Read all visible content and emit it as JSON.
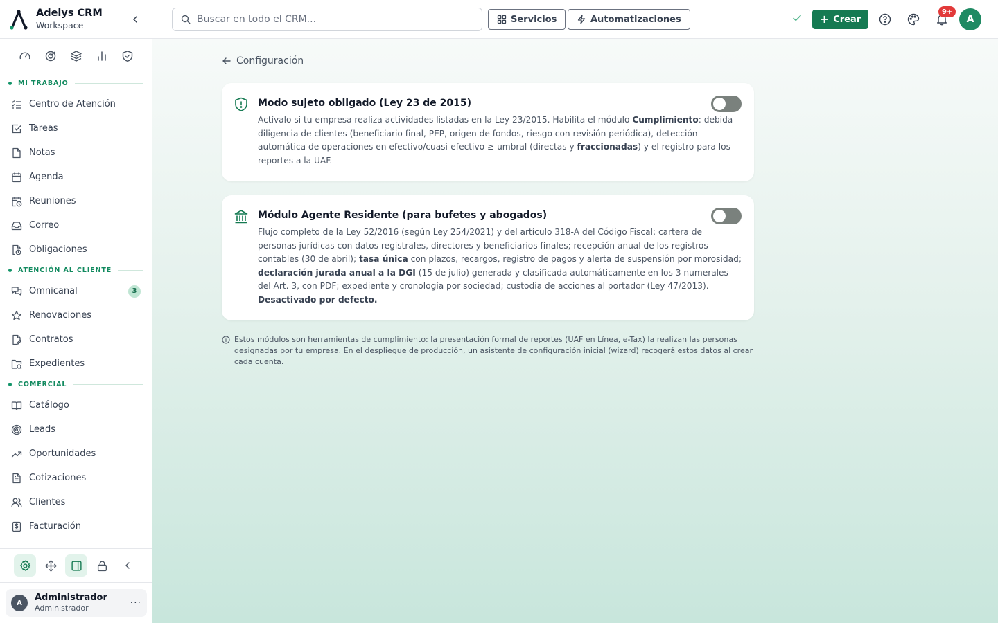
{
  "brand": {
    "name": "Adelys CRM",
    "subtitle": "Workspace"
  },
  "colors": {
    "accent": "#157a52",
    "badge": "#e23a3a",
    "toggle_off": "#7a817d"
  },
  "quick_icons": [
    "gauge-icon",
    "target-icon",
    "layers-icon",
    "bar-chart-icon",
    "shield-check-icon"
  ],
  "sections": {
    "mi_trabajo": "MI TRABAJO",
    "atencion": "ATENCIÓN AL CLIENTE",
    "comercial": "COMERCIAL"
  },
  "nav": {
    "centro": "Centro de Atención",
    "tareas": "Tareas",
    "notas": "Notas",
    "agenda": "Agenda",
    "reuniones": "Reuniones",
    "correo": "Correo",
    "obligaciones": "Obligaciones",
    "omnicanal": "Omnicanal",
    "omnicanal_count": "3",
    "renovaciones": "Renovaciones",
    "contratos": "Contratos",
    "expedientes": "Expedientes",
    "catalogo": "Catálogo",
    "leads": "Leads",
    "oportunidades": "Oportunidades",
    "cotizaciones": "Cotizaciones",
    "clientes": "Clientes",
    "facturacion": "Facturación"
  },
  "user": {
    "initial": "A",
    "name": "Administrador",
    "role": "Administrador",
    "menu": "···"
  },
  "topbar": {
    "search_placeholder": "Buscar en todo el CRM...",
    "servicios": "Servicios",
    "automatizaciones": "Automatizaciones",
    "crear": "Crear",
    "notifications_badge": "9+",
    "avatar_initial": "A"
  },
  "page": {
    "back_label": "Configuración",
    "card1": {
      "title": "Modo sujeto obligado (Ley 23 de 2015)",
      "enabled": false,
      "t1": "Actívalo si tu empresa realiza actividades listadas en la Ley 23/2015. Habilita el módulo ",
      "b1": "Cumplimiento",
      "t2": ": debida diligencia de clientes (beneficiario final, PEP, origen de fondos, riesgo con revisión periódica), detección automática de operaciones en efectivo/cuasi-efectivo ≥ umbral (directas y ",
      "b2": "fraccionadas",
      "t3": ") y el registro para los reportes a la UAF."
    },
    "card2": {
      "title": "Módulo Agente Residente (para bufetes y abogados)",
      "enabled": false,
      "t1": "Flujo completo de la Ley 52/2016 (según Ley 254/2021) y del artículo 318-A del Código Fiscal: cartera de personas jurídicas con datos registrales, directores y beneficiarios finales; recepción anual de los registros contables (30 de abril); ",
      "b1": "tasa única",
      "t2": " con plazos, recargos, registro de pagos y alerta de suspensión por morosidad; ",
      "b2": "declaración jurada anual a la DGI",
      "t3": " (15 de julio) generada y clasificada automáticamente en los 3 numerales del Art. 3, con PDF; expediente y cronología por sociedad; custodia de acciones al portador (Ley 47/2013). ",
      "b3": "Desactivado por defecto."
    },
    "note": "Estos módulos son herramientas de cumplimiento: la presentación formal de reportes (UAF en Línea, e-Tax) la realizan las personas designadas por tu empresa. En el despliegue de producción, un asistente de configuración inicial (wizard) recogerá estos datos al crear cada cuenta."
  }
}
